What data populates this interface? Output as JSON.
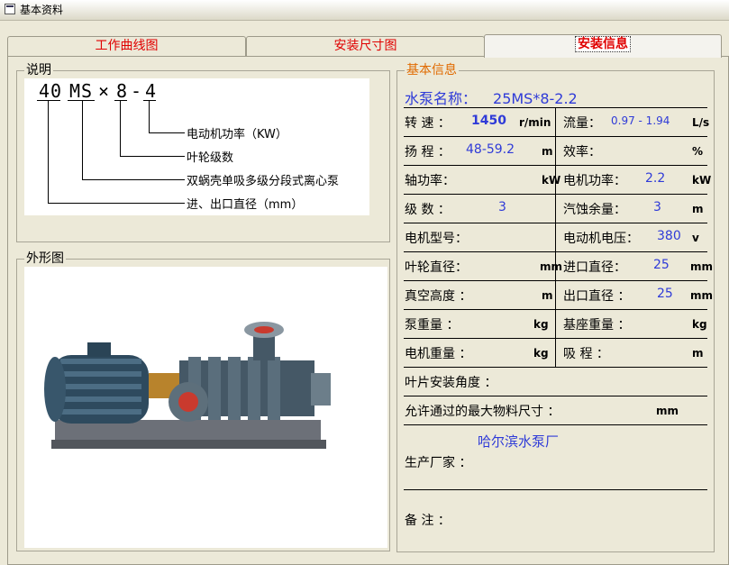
{
  "window": {
    "title": "基本资料",
    "icon": "window-icon"
  },
  "tabs": [
    {
      "label": "工作曲线图"
    },
    {
      "label": "安装尺寸图"
    },
    {
      "label": "安装信息"
    }
  ],
  "explain": {
    "legend": "说明",
    "model_chars": [
      "40",
      "MS",
      "×",
      "8",
      "-",
      "4"
    ],
    "labels": [
      "电动机功率（KW）",
      "叶轮级数",
      "双蜗壳单吸多级分段式离心泵",
      "进、出口直径（mm）"
    ]
  },
  "photo": {
    "legend": "外形图",
    "image": "multistage-centrifugal-pump-photo"
  },
  "info": {
    "legend": "基本信息",
    "pump_name_label": "水泵名称：",
    "pump_name_value": "25MS*8-2.2",
    "speed_label": "转 速 ：",
    "speed_value": "1450",
    "speed_unit": "r/min",
    "flow_label": "流量：",
    "flow_value": "0.97 - 1.94",
    "flow_unit": "L/s",
    "head_label": "扬 程 ：",
    "head_value": "48-59.2",
    "head_unit": "m",
    "eff_label": "效率：",
    "eff_value": "",
    "eff_unit": "%",
    "shaft_label": "轴功率：",
    "shaft_value": "",
    "shaft_unit": "kW",
    "motor_power_label": "电机功率：",
    "motor_power_value": "2.2",
    "motor_power_unit": "kW",
    "stage_label": "级 数 ：",
    "stage_value": "3",
    "npsh_label": "汽蚀余量：",
    "npsh_value": "3",
    "npsh_unit": "m",
    "motor_model_label": "电机型号：",
    "motor_model_value": "",
    "motor_voltage_label": "电动机电压：",
    "motor_voltage_value": "380",
    "motor_voltage_unit": "v",
    "impeller_label": "叶轮直径：",
    "impeller_value": "",
    "impeller_unit": "mm",
    "inlet_label": "进口直径：",
    "inlet_value": "25",
    "inlet_unit": "mm",
    "vacuum_label": "真空高度 ：",
    "vacuum_value": "",
    "vacuum_unit": "m",
    "outlet_label": "出口直径 ：",
    "outlet_value": "25",
    "outlet_unit": "mm",
    "pump_weight_label": "泵重量 ：",
    "pump_weight_unit": "kg",
    "base_weight_label": "基座重量 ：",
    "base_weight_unit": "kg",
    "motor_weight_label": "电机重量 ：",
    "motor_weight_unit": "kg",
    "suction_label": "吸 程 ：",
    "suction_unit": "m",
    "blade_angle_label": "叶片安装角度 ：",
    "max_particle_label": "允许通过的最大物料尺寸 ：",
    "max_particle_unit": "mm",
    "maker_value": "哈尔滨水泵厂",
    "maker_label": "生产厂家 ：",
    "remark_label": "备  注 ："
  }
}
